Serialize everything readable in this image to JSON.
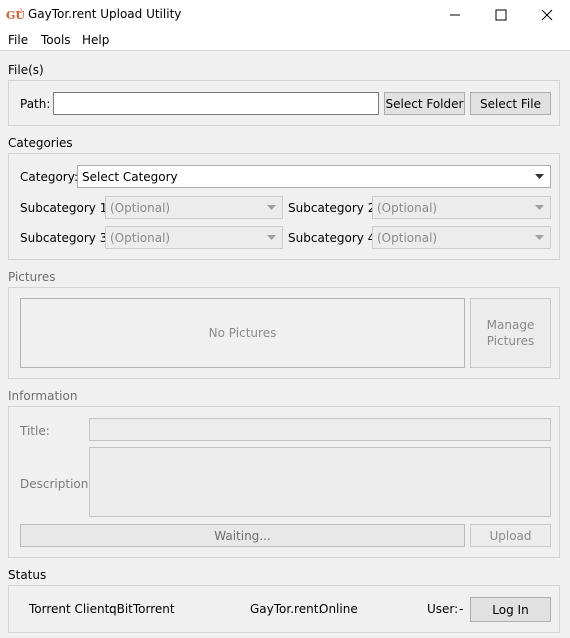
{
  "window": {
    "title": "GayTor.rent Upload Utility",
    "icon": "app-logo-icon",
    "accent_color": "#e2562b"
  },
  "menu": [
    "File",
    "Tools",
    "Help"
  ],
  "files": {
    "section_label": "File(s)",
    "path_label": "Path:",
    "path_value": "",
    "select_folder_label": "Select Folder",
    "select_file_label": "Select File"
  },
  "categories": {
    "section_label": "Categories",
    "category_label": "Category:",
    "category_value": "Select Category",
    "sub1_label": "Subcategory 1:",
    "sub1_value": "(Optional)",
    "sub2_label": "Subcategory 2:",
    "sub2_value": "(Optional)",
    "sub3_label": "Subcategory 3:",
    "sub3_value": "(Optional)",
    "sub4_label": "Subcategory 4:",
    "sub4_value": "(Optional)"
  },
  "pictures": {
    "section_label": "Pictures",
    "empty_text": "No Pictures",
    "manage_line1": "Manage",
    "manage_line2": "Pictures"
  },
  "information": {
    "section_label": "Information",
    "title_label": "Title:",
    "title_value": "",
    "description_label": "Description:",
    "description_value": "",
    "progress_text": "Waiting...",
    "upload_label": "Upload"
  },
  "status": {
    "section_label": "Status",
    "client_label": "Torrent Client:",
    "client_value": "qBitTorrent",
    "site_label": "GayTor.rent:",
    "site_value": "Online",
    "user_label": "User:",
    "user_value": "-",
    "login_label": "Log In"
  }
}
